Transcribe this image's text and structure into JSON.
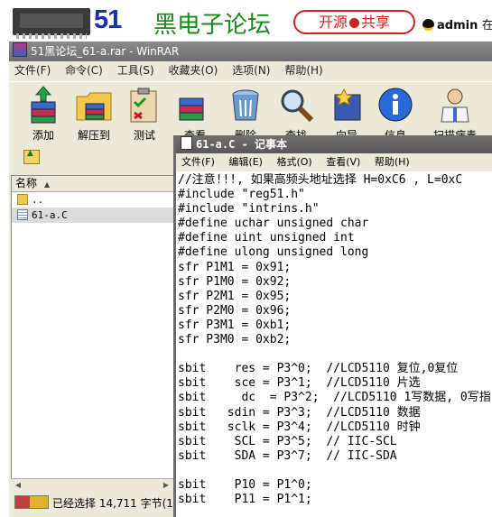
{
  "banner": {
    "logo_number": "51",
    "logo_name": "黑电子论坛",
    "share_left": "开源",
    "share_right": "共享",
    "username": "admin",
    "user_suffix": "在线"
  },
  "winrar": {
    "title": "51黑论坛_61-a.rar - WinRAR",
    "menu": [
      "文件(F)",
      "命令(C)",
      "工具(S)",
      "收藏夹(O)",
      "选项(N)",
      "帮助(H)"
    ],
    "toolbar": [
      {
        "label": "添加",
        "icon": "add-books-icon"
      },
      {
        "label": "解压到",
        "icon": "extract-folder-icon"
      },
      {
        "label": "测试",
        "icon": "test-clipboard-icon"
      },
      {
        "label": "查看",
        "icon": "view-books-icon"
      },
      {
        "label": "删除",
        "icon": "delete-bin-icon"
      },
      {
        "label": "查找",
        "icon": "find-magnifier-icon"
      },
      {
        "label": "向导",
        "icon": "wizard-icon"
      },
      {
        "label": "信息",
        "icon": "info-icon"
      },
      {
        "label": "扫描病毒",
        "icon": "virus-scan-doctor-icon"
      }
    ],
    "list_header": "名称",
    "files": [
      {
        "name": "..",
        "icon": "folder-up-icon"
      },
      {
        "name": "61-a.C",
        "icon": "text-file-icon"
      }
    ],
    "status": "已经选择 14,711 字节(1"
  },
  "notepad": {
    "title": "61-a.C - 记事本",
    "menu": [
      "文件(F)",
      "编辑(E)",
      "格式(O)",
      "查看(V)",
      "帮助(H)"
    ],
    "lines": [
      "//注意!!!, 如果高频头地址选择 H=0xC6 , L=0xC",
      "#include \"reg51.h\"",
      "#include \"intrins.h\"",
      "#define uchar unsigned char",
      "#define uint unsigned int",
      "#define ulong unsigned long",
      "sfr P1M1 = 0x91;",
      "sfr P1M0 = 0x92;",
      "sfr P2M1 = 0x95;",
      "sfr P2M0 = 0x96;",
      "sfr P3M1 = 0xb1;",
      "sfr P3M0 = 0xb2;",
      "",
      "sbit    res = P3^0;  //LCD5110 复位,0复位",
      "sbit    sce = P3^1;  //LCD5110 片选",
      "sbit     dc  = P3^2;  //LCD5110 1写数据, 0写指",
      "sbit   sdin = P3^3;  //LCD5110 数据",
      "sbit   sclk = P3^4;  //LCD5110 时钟",
      "sbit    SCL = P3^5;  // IIC-SCL",
      "sbit    SDA = P3^7;  // IIC-SDA",
      "",
      "sbit    P10 = P1^0;",
      "sbit    P11 = P1^1;"
    ]
  }
}
